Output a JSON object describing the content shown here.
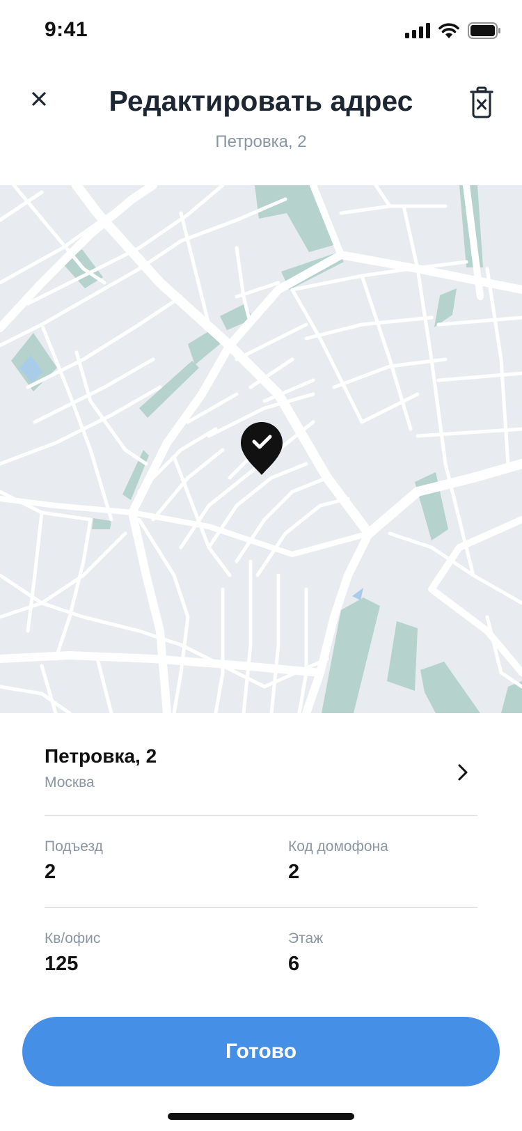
{
  "status_bar": {
    "time": "9:41"
  },
  "header": {
    "title": "Редактировать адрес",
    "subtitle": "Петровка, 2"
  },
  "address": {
    "street": "Петровка, 2",
    "city": "Москва"
  },
  "fields": {
    "entrance": {
      "label": "Подъезд",
      "value": "2"
    },
    "intercom": {
      "label": "Код домофона",
      "value": "2"
    },
    "apartment": {
      "label": "Кв/офис",
      "value": "125"
    },
    "floor": {
      "label": "Этаж",
      "value": "6"
    }
  },
  "actions": {
    "done_label": "Готово"
  },
  "colors": {
    "accent": "#4590e6",
    "map_land": "#e8ebf0",
    "map_park": "#b5d3cc",
    "map_water": "#a9cde9",
    "text_primary": "#16202c",
    "text_secondary": "#8a96a3"
  }
}
